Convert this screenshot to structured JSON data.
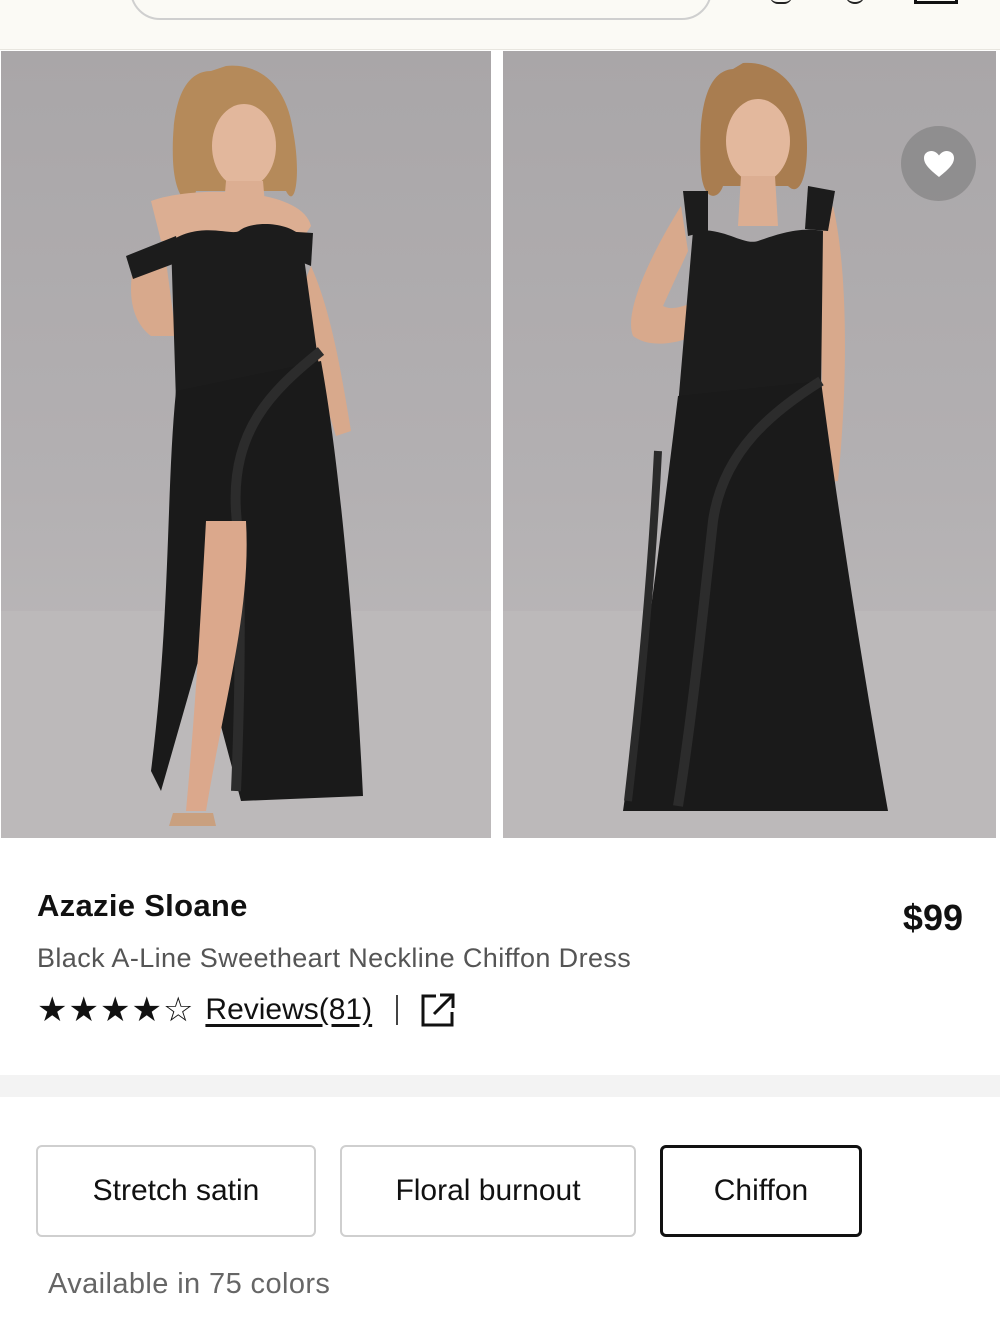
{
  "product": {
    "brand": "Azazie Sloane",
    "price": "$99",
    "subtitle": "Black A-Line Sweetheart Neckline Chiffon Dress",
    "rating": 4,
    "rating_max": 5,
    "reviews_label": "Reviews(81)"
  },
  "images": [
    {
      "name": "off-shoulder-dress-photo"
    },
    {
      "name": "square-neck-dress-photo"
    }
  ],
  "fabrics": {
    "options": [
      "Stretch satin",
      "Floral burnout",
      "Chiffon"
    ],
    "selected": "Chiffon"
  },
  "colors_text": "Available in 75 colors",
  "icons": {
    "favorite": "heart-icon",
    "external": "external-link-icon",
    "star_full": "star-filled-icon",
    "star_empty": "star-outline-icon"
  },
  "palette": {
    "text": "#111111",
    "muted": "#555555",
    "dress": "#1c1c1c",
    "backdrop": "#b1aeb0"
  }
}
